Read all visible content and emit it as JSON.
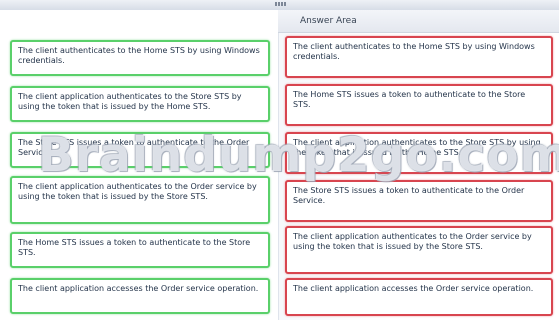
{
  "answer_area": {
    "title": "Answer Area"
  },
  "source_items": [
    "The client authenticates to the Home STS by using Windows credentials.",
    "The client application authenticates to the Store STS by using the token that is issued by the Home STS.",
    "The Store STS issues a token to authenticate to the Order Service.",
    "The client application authenticates to the Order service by using the token that is issued by the Store STS.",
    "The Home STS issues a token to authenticate to the Store STS.",
    "The client application accesses the Order service operation."
  ],
  "answer_items": [
    "The client authenticates to the Home STS by using Windows credentials.",
    "The Home STS issues a token to authenticate to the Store STS.",
    "The client application authenticates to the Store STS by using the token that is issued by the Home STS.",
    "The Store STS issues a token to authenticate to the Order Service.",
    "The client application authenticates to the Order service by using the token that is issued by the Store STS.",
    "The client application accesses the Order service operation."
  ],
  "watermark": "Braindump2go.com",
  "colors": {
    "source_border": "#5ad06a",
    "answer_border": "#d8454f"
  }
}
